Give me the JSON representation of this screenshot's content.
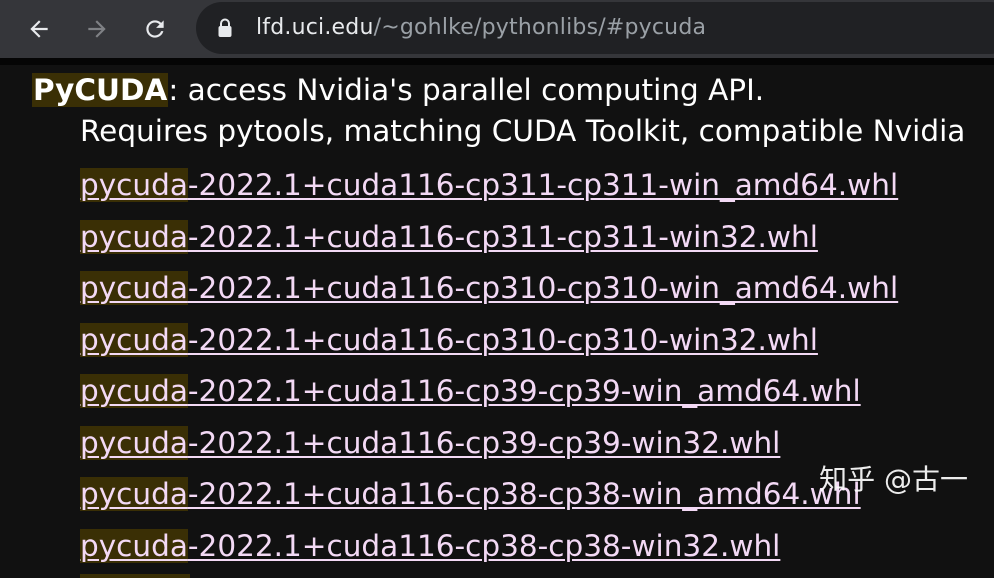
{
  "browser": {
    "back_icon": "arrow-left-icon",
    "forward_icon": "arrow-right-icon",
    "reload_icon": "reload-icon",
    "lock_icon": "lock-icon",
    "url_host": "lfd.uci.edu",
    "url_path": "/~gohlke/pythonlibs/#pycuda"
  },
  "page": {
    "package_name": "PyCUDA",
    "package_desc": ": access Nvidia's parallel computing API.",
    "requires": "Requires pytools, matching CUDA Toolkit, compatible Nvidia",
    "links": [
      {
        "prefix": "pycuda",
        "rest": "-2022.1+cuda116-cp311-cp311-win_amd64.whl"
      },
      {
        "prefix": "pycuda",
        "rest": "-2022.1+cuda116-cp311-cp311-win32.whl"
      },
      {
        "prefix": "pycuda",
        "rest": "-2022.1+cuda116-cp310-cp310-win_amd64.whl"
      },
      {
        "prefix": "pycuda",
        "rest": "-2022.1+cuda116-cp310-cp310-win32.whl"
      },
      {
        "prefix": "pycuda",
        "rest": "-2022.1+cuda116-cp39-cp39-win_amd64.whl"
      },
      {
        "prefix": "pycuda",
        "rest": "-2022.1+cuda116-cp39-cp39-win32.whl"
      },
      {
        "prefix": "pycuda",
        "rest": "-2022.1+cuda116-cp38-cp38-win_amd64.whl"
      },
      {
        "prefix": "pycuda",
        "rest": "-2022.1+cuda116-cp38-cp38-win32.whl"
      }
    ]
  },
  "watermark": "知乎 @古一",
  "colors": {
    "toolbar_bg": "#35363a",
    "omnibox_bg": "#202124",
    "page_bg": "#111111",
    "link_text": "#f3d9f5",
    "find_highlight": "#3a2f05"
  }
}
